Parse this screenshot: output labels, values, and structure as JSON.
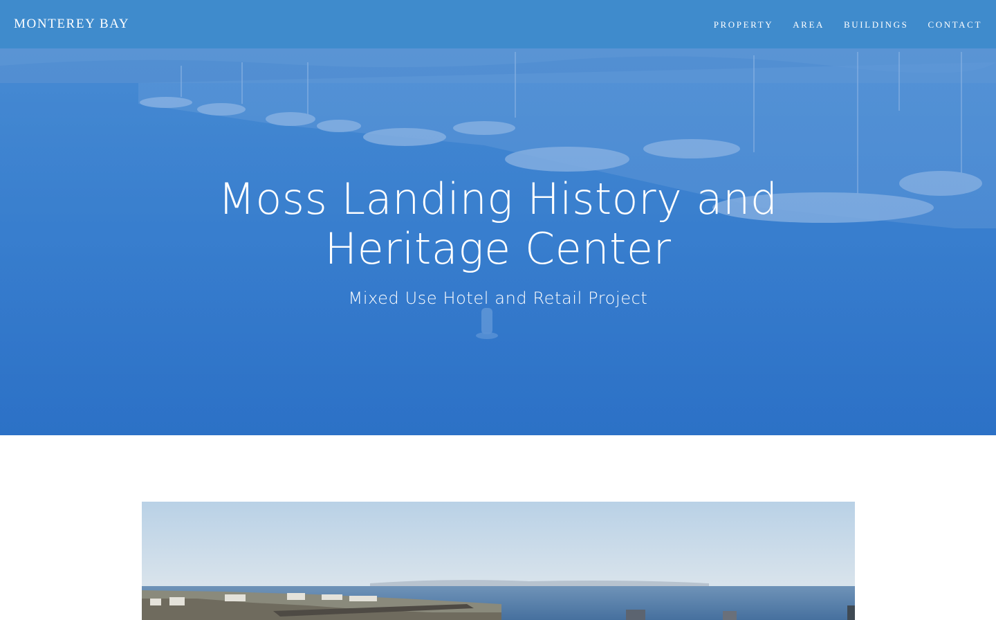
{
  "header": {
    "brand": "MONTEREY BAY",
    "nav": [
      {
        "label": "PROPERTY"
      },
      {
        "label": "AREA"
      },
      {
        "label": "BUILDINGS"
      },
      {
        "label": "CONTACT"
      }
    ]
  },
  "hero": {
    "title_line1": "Moss Landing History and",
    "title_line2": "Heritage Center",
    "subtitle": "Mixed Use Hotel and Retail Project"
  },
  "colors": {
    "nav_bar": "#3f8bcc",
    "hero_tint": "#2f72c6",
    "text": "#ffffff",
    "page_background": "#ffffff"
  }
}
